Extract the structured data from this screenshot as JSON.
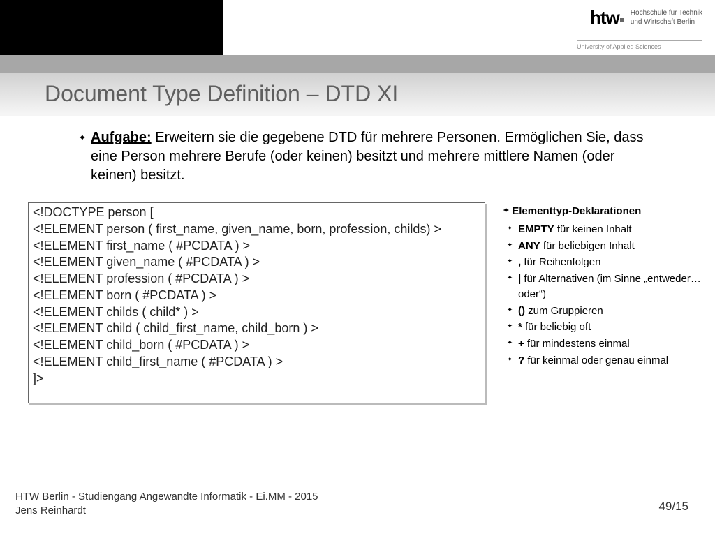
{
  "logo": {
    "mark": "htw",
    "line1": "Hochschule für Technik",
    "line2": "und Wirtschaft Berlin",
    "sub": "University of Applied Sciences"
  },
  "title": "Document Type Definition – DTD XI",
  "task": {
    "label": "Aufgabe:",
    "body": " Erweitern sie die gegebene DTD für mehrere Personen. Ermöglichen Sie, dass eine Person mehrere Berufe (oder keinen) besitzt und mehrere mittlere Namen (oder keinen) besitzt."
  },
  "code": [
    "<!DOCTYPE person [",
    "<!ELEMENT person ( first_name, given_name, born, profession, childs) >",
    "<!ELEMENT first_name ( #PCDATA ) >",
    "<!ELEMENT given_name ( #PCDATA ) >",
    "<!ELEMENT profession ( #PCDATA ) >",
    "<!ELEMENT born ( #PCDATA ) >",
    "<!ELEMENT childs ( child* ) >",
    "<!ELEMENT child ( child_first_name, child_born ) >",
    "<!ELEMENT child_born ( #PCDATA ) >",
    "<!ELEMENT child_first_name ( #PCDATA ) >",
    "]>"
  ],
  "decl": {
    "heading": "Elementtyp-Deklarationen",
    "items": [
      {
        "sym": "EMPTY",
        "text": " für keinen Inhalt"
      },
      {
        "sym": "ANY",
        "text": " für beliebigen Inhalt"
      },
      {
        "sym": ",",
        "text": " für Reihenfolgen"
      },
      {
        "sym": "|",
        "text": " für Alternativen (im Sinne „entweder…oder“)"
      },
      {
        "sym": "()",
        "text": " zum Gruppieren"
      },
      {
        "sym": "*",
        "text": " für beliebig oft"
      },
      {
        "sym": "+",
        "text": " für mindestens einmal"
      },
      {
        "sym": "?",
        "text": " für keinmal oder genau einmal"
      }
    ]
  },
  "footer": {
    "left1": "HTW Berlin - Studiengang Angewandte Informatik - Ei.MM - 2015",
    "left2": "Jens Reinhardt",
    "right": "49/15"
  }
}
